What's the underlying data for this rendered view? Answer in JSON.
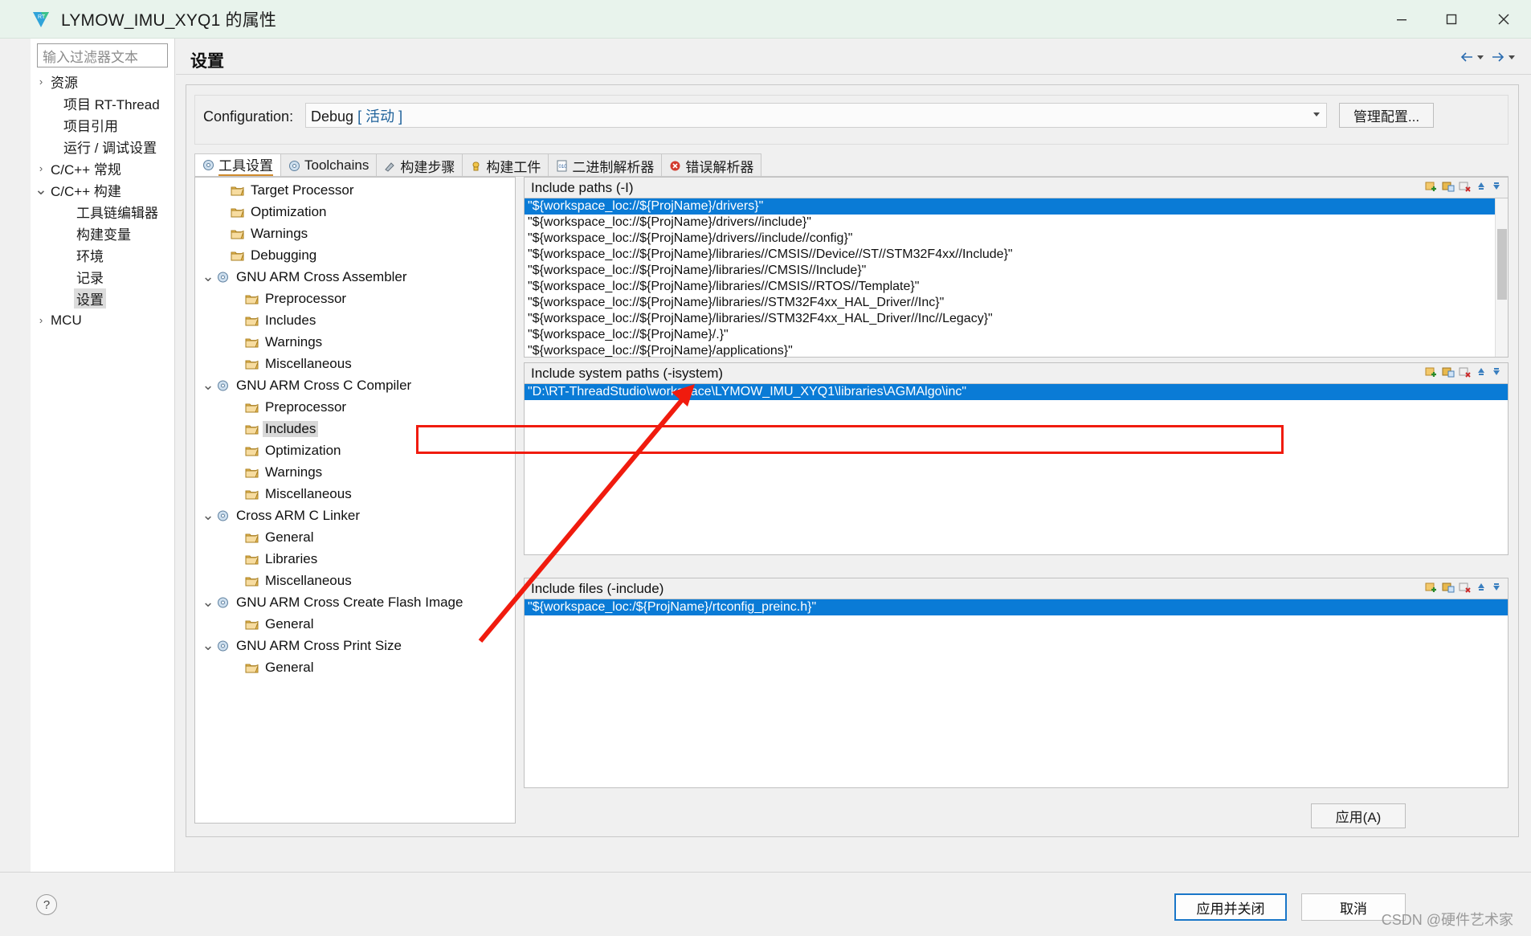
{
  "window": {
    "title": "LYMOW_IMU_XYQ1 的属性",
    "app_icon": "rt-thread-icon",
    "minimize_label": "最小化",
    "maximize_label": "最大化",
    "close_label": "关闭"
  },
  "sidebar": {
    "filter_placeholder": "输入过滤器文本",
    "items": [
      {
        "label": "资源",
        "arrow": "collapsed",
        "indent": 0,
        "selected": false
      },
      {
        "label": "项目 RT-Thread",
        "arrow": "none",
        "indent": 1,
        "selected": false
      },
      {
        "label": "项目引用",
        "arrow": "none",
        "indent": 1,
        "selected": false
      },
      {
        "label": "运行 / 调试设置",
        "arrow": "none",
        "indent": 1,
        "selected": false
      },
      {
        "label": "C/C++ 常规",
        "arrow": "collapsed",
        "indent": 0,
        "selected": false
      },
      {
        "label": "C/C++ 构建",
        "arrow": "expanded",
        "indent": 0,
        "selected": false
      },
      {
        "label": "工具链编辑器",
        "arrow": "none",
        "indent": 2,
        "selected": false
      },
      {
        "label": "构建变量",
        "arrow": "none",
        "indent": 2,
        "selected": false
      },
      {
        "label": "环境",
        "arrow": "none",
        "indent": 2,
        "selected": false
      },
      {
        "label": "记录",
        "arrow": "none",
        "indent": 2,
        "selected": false
      },
      {
        "label": "设置",
        "arrow": "none",
        "indent": 2,
        "selected": true
      },
      {
        "label": "MCU",
        "arrow": "collapsed",
        "indent": 0,
        "selected": false
      }
    ]
  },
  "page": {
    "title": "设置",
    "nav_back_icon": "arrow-left-icon",
    "nav_forward_icon": "arrow-right-icon"
  },
  "configuration": {
    "label": "Configuration:",
    "value": "Debug",
    "value_suffix": "[ 活动 ]",
    "manage_button": "管理配置..."
  },
  "tabs": [
    {
      "label": "工具设置",
      "icon": "tool-settings-icon",
      "active": true
    },
    {
      "label": "Toolchains",
      "icon": "toolchains-icon",
      "active": false
    },
    {
      "label": "构建步骤",
      "icon": "build-steps-icon",
      "active": false
    },
    {
      "label": "构建工件",
      "icon": "build-artifact-icon",
      "active": false
    },
    {
      "label": "二进制解析器",
      "icon": "binary-parser-icon",
      "active": false
    },
    {
      "label": "错误解析器",
      "icon": "error-parser-icon",
      "active": false
    }
  ],
  "tool_tree": [
    {
      "label": "Target Processor",
      "indent": 1,
      "arrow": "none",
      "icon": "folder-icon",
      "selected": false
    },
    {
      "label": "Optimization",
      "indent": 1,
      "arrow": "none",
      "icon": "folder-icon",
      "selected": false
    },
    {
      "label": "Warnings",
      "indent": 1,
      "arrow": "none",
      "icon": "folder-icon",
      "selected": false
    },
    {
      "label": "Debugging",
      "indent": 1,
      "arrow": "none",
      "icon": "folder-icon",
      "selected": false
    },
    {
      "label": "GNU ARM Cross Assembler",
      "indent": 0,
      "arrow": "expanded",
      "icon": "tool-icon",
      "selected": false
    },
    {
      "label": "Preprocessor",
      "indent": 2,
      "arrow": "none",
      "icon": "folder-icon",
      "selected": false
    },
    {
      "label": "Includes",
      "indent": 2,
      "arrow": "none",
      "icon": "folder-icon",
      "selected": false
    },
    {
      "label": "Warnings",
      "indent": 2,
      "arrow": "none",
      "icon": "folder-icon",
      "selected": false
    },
    {
      "label": "Miscellaneous",
      "indent": 2,
      "arrow": "none",
      "icon": "folder-icon",
      "selected": false
    },
    {
      "label": "GNU ARM Cross C Compiler",
      "indent": 0,
      "arrow": "expanded",
      "icon": "tool-icon",
      "selected": false
    },
    {
      "label": "Preprocessor",
      "indent": 2,
      "arrow": "none",
      "icon": "folder-icon",
      "selected": false
    },
    {
      "label": "Includes",
      "indent": 2,
      "arrow": "none",
      "icon": "folder-icon",
      "selected": true
    },
    {
      "label": "Optimization",
      "indent": 2,
      "arrow": "none",
      "icon": "folder-icon",
      "selected": false
    },
    {
      "label": "Warnings",
      "indent": 2,
      "arrow": "none",
      "icon": "folder-icon",
      "selected": false
    },
    {
      "label": "Miscellaneous",
      "indent": 2,
      "arrow": "none",
      "icon": "folder-icon",
      "selected": false
    },
    {
      "label": "Cross ARM C Linker",
      "indent": 0,
      "arrow": "expanded",
      "icon": "tool-icon",
      "selected": false
    },
    {
      "label": "General",
      "indent": 2,
      "arrow": "none",
      "icon": "folder-icon",
      "selected": false
    },
    {
      "label": "Libraries",
      "indent": 2,
      "arrow": "none",
      "icon": "folder-icon",
      "selected": false
    },
    {
      "label": "Miscellaneous",
      "indent": 2,
      "arrow": "none",
      "icon": "folder-icon",
      "selected": false
    },
    {
      "label": "GNU ARM Cross Create Flash Image",
      "indent": 0,
      "arrow": "expanded",
      "icon": "tool-icon",
      "selected": false
    },
    {
      "label": "General",
      "indent": 2,
      "arrow": "none",
      "icon": "folder-icon",
      "selected": false
    },
    {
      "label": "GNU ARM Cross Print Size",
      "indent": 0,
      "arrow": "expanded",
      "icon": "tool-icon",
      "selected": false
    },
    {
      "label": "General",
      "indent": 2,
      "arrow": "none",
      "icon": "folder-icon",
      "selected": false
    }
  ],
  "include_paths": {
    "title": "Include paths (-I)",
    "toolbar_icons": [
      "add-icon",
      "add-folder-icon",
      "delete-icon",
      "move-up-icon",
      "move-down-icon"
    ],
    "items": [
      {
        "value": "\"${workspace_loc://${ProjName}/drivers}\"",
        "selected": true
      },
      {
        "value": "\"${workspace_loc://${ProjName}/drivers//include}\"",
        "selected": false
      },
      {
        "value": "\"${workspace_loc://${ProjName}/drivers//include//config}\"",
        "selected": false
      },
      {
        "value": "\"${workspace_loc://${ProjName}/libraries//CMSIS//Device//ST//STM32F4xx//Include}\"",
        "selected": false
      },
      {
        "value": "\"${workspace_loc://${ProjName}/libraries//CMSIS//Include}\"",
        "selected": false
      },
      {
        "value": "\"${workspace_loc://${ProjName}/libraries//CMSIS//RTOS//Template}\"",
        "selected": false
      },
      {
        "value": "\"${workspace_loc://${ProjName}/libraries//STM32F4xx_HAL_Driver//Inc}\"",
        "selected": false
      },
      {
        "value": "\"${workspace_loc://${ProjName}/libraries//STM32F4xx_HAL_Driver//Inc//Legacy}\"",
        "selected": false
      },
      {
        "value": "\"${workspace_loc://${ProjName}/.}\"",
        "selected": false
      },
      {
        "value": "\"${workspace_loc://${ProjName}/applications}\"",
        "selected": false
      }
    ]
  },
  "include_system_paths": {
    "title": "Include system paths (-isystem)",
    "toolbar_icons": [
      "add-icon",
      "add-folder-icon",
      "delete-icon",
      "move-up-icon",
      "move-down-icon"
    ],
    "items": [
      {
        "value": "\"D:\\RT-ThreadStudio\\workspace\\LYMOW_IMU_XYQ1\\libraries\\AGMAlgo\\inc\"",
        "selected": true,
        "highlighted": true
      }
    ]
  },
  "include_files": {
    "title": "Include files (-include)",
    "toolbar_icons": [
      "add-icon",
      "add-folder-icon",
      "delete-icon",
      "move-up-icon",
      "move-down-icon"
    ],
    "items": [
      {
        "value": "\"${workspace_loc:/${ProjName}/rtconfig_preinc.h}\"",
        "selected": true
      }
    ]
  },
  "buttons": {
    "apply": "应用(A)",
    "apply_and_close": "应用并关闭",
    "cancel": "取消",
    "help_icon": "help-icon"
  },
  "watermark": "CSDN @硬件艺术家",
  "colors": {
    "selection_blue": "#0a7bd6",
    "annotation_red": "#f01b0e",
    "titlebar_green": "#e8f3ec",
    "panel_gray": "#f0f0f0"
  }
}
